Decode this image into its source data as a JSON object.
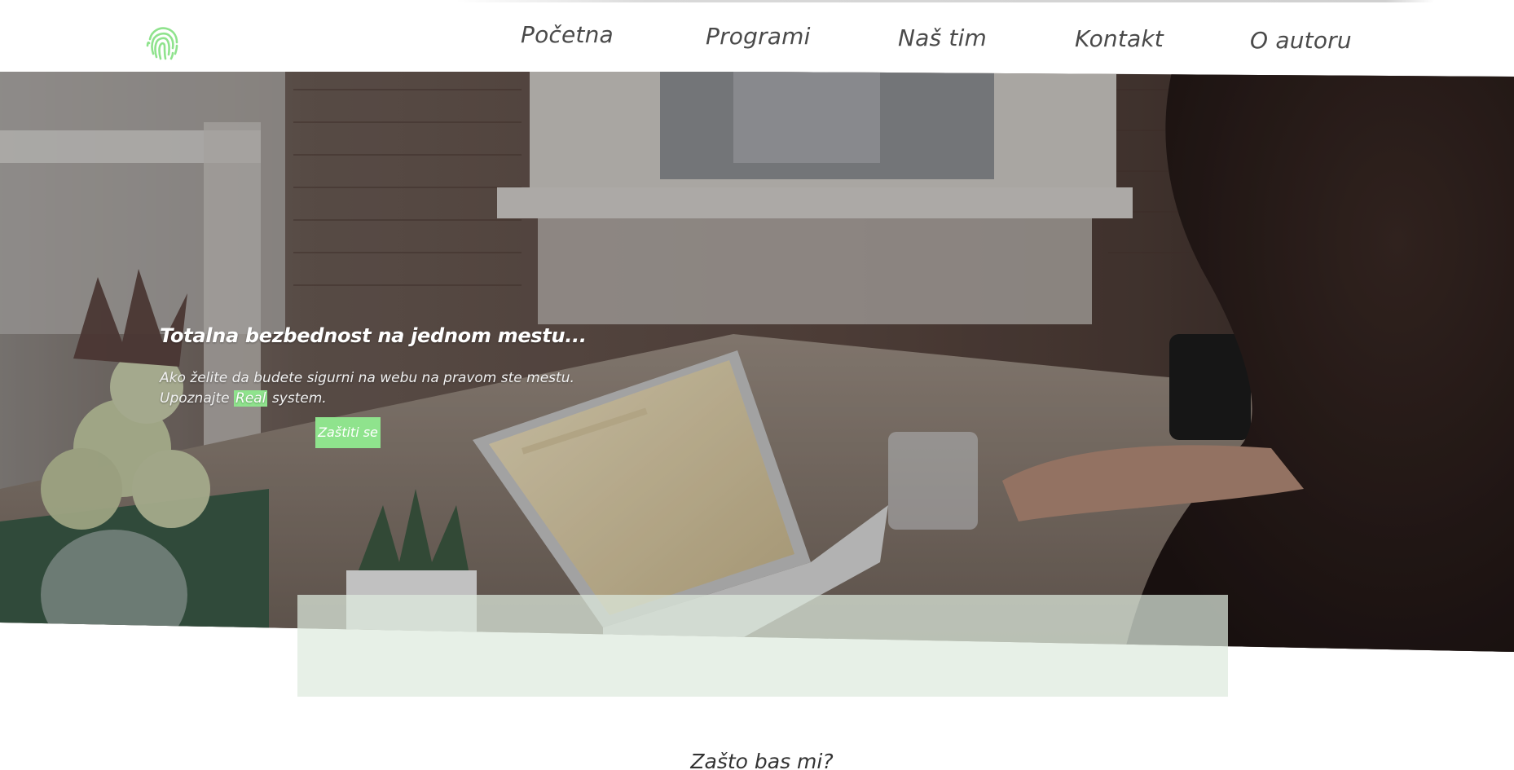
{
  "header": {
    "logo_icon": "fingerprint-icon",
    "brand_color": "#8fe38d",
    "nav": [
      {
        "label": "Početna"
      },
      {
        "label": "Programi"
      },
      {
        "label": "Naš tim"
      },
      {
        "label": "Kontakt"
      },
      {
        "label": "O autoru"
      }
    ]
  },
  "hero": {
    "title": "Totalna bezbednost na jednom mestu...",
    "description_line1": "Ako želite da budete sigurni na webu na pravom ste mestu.",
    "description_prefix": "Upoznajte",
    "description_highlight": "Real",
    "description_suffix": "system.",
    "cta_label": "Zaštiti se",
    "highlight_color": "#8fe38d"
  },
  "section": {
    "title": "Zašto bas mi?"
  }
}
